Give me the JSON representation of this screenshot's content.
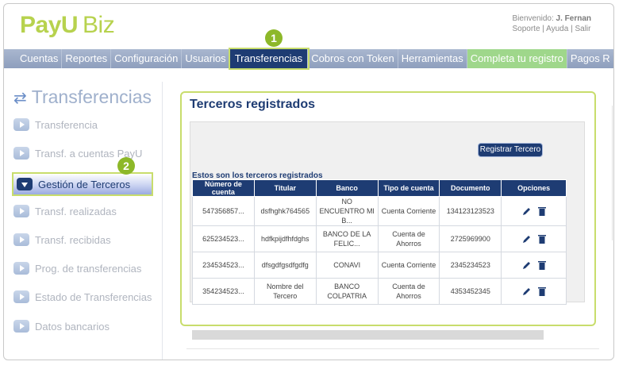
{
  "logo": {
    "payu": "PayU",
    "biz": "Biz"
  },
  "user": {
    "greeting": "Bienvenido:",
    "name": "J. Fernan",
    "links": [
      "Soporte",
      "Ayuda",
      "Salir"
    ]
  },
  "nav": [
    "Cuentas",
    "Reportes",
    "Configuración",
    "Usuarios",
    "Transferencias",
    "Cobros con Token",
    "Herramientas",
    "Completa tu registro",
    "Pagos R"
  ],
  "badges": [
    "1",
    "2"
  ],
  "sidebar": {
    "title": "Transferencias",
    "items": [
      "Transferencia",
      "Transf. a cuentas PayU",
      "Gestión de Terceros",
      "Transf. realizadas",
      "Transf. recibidas",
      "Prog. de transferencias",
      "Estado de Transferencias",
      "Datos bancarios"
    ]
  },
  "main": {
    "title": "Terceros registrados",
    "register_button": "Registrar Tercero",
    "caption": "Estos son los terceros registrados",
    "columns": [
      "Número de cuenta",
      "Titular",
      "Banco",
      "Tipo de cuenta",
      "Documento",
      "Opciones"
    ],
    "rows": [
      [
        "547356857...",
        "dsfhghk764565",
        "NO ENCUENTRO MI B...",
        "Cuenta Corriente",
        "134123123523"
      ],
      [
        "625234523...",
        "hdfkpijdfhfdghs",
        "BANCO DE LA FELIC...",
        "Cuenta de Ahorros",
        "2725969900"
      ],
      [
        "234534523...",
        "dfsgdfgsdfgdfg",
        "CONAVI",
        "Cuenta Corriente",
        "2345234523"
      ],
      [
        "354234523...",
        "Nombre del Tercero",
        "BANCO COLPATRIA",
        "Cuenta de Ahorros",
        "4353452345"
      ]
    ]
  },
  "colors": {
    "navy": "#1e3c73",
    "lime": "#c8dd6c",
    "green_badge": "#8db829",
    "cta": "#9fd78b"
  }
}
